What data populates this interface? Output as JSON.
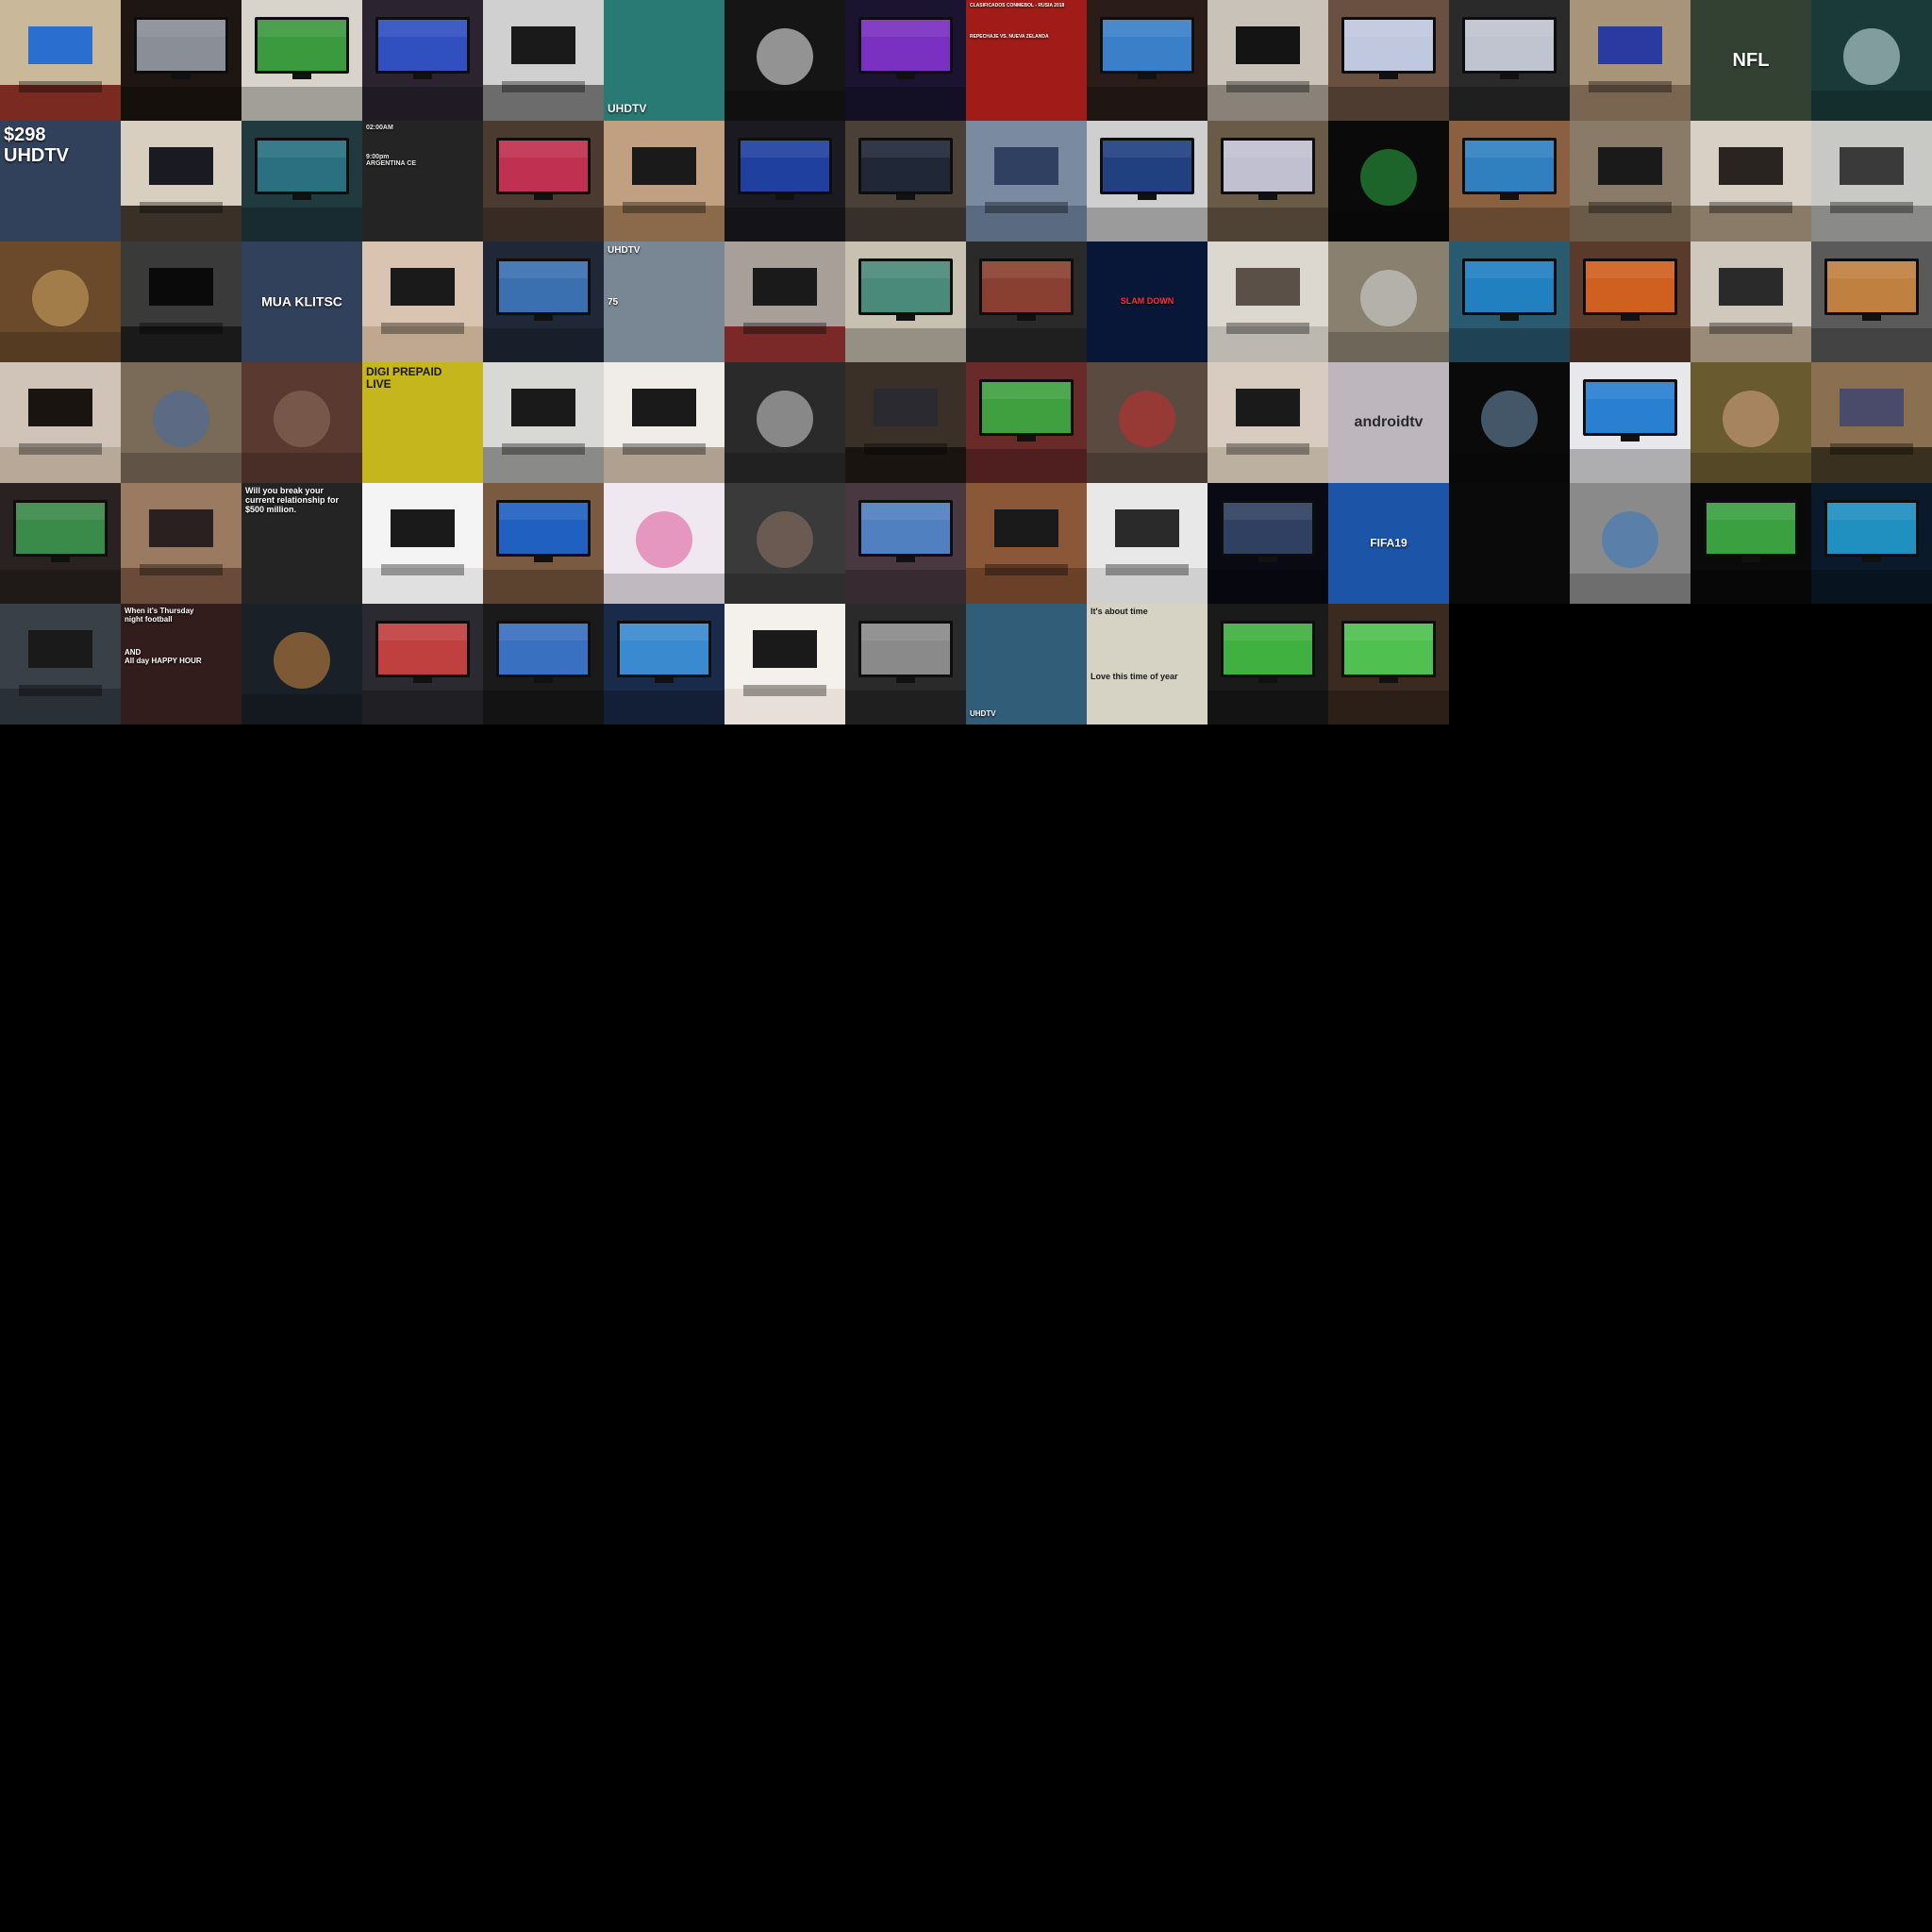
{
  "grid": {
    "columns": 16,
    "rows": 6,
    "background": "#000000"
  },
  "tiles": [
    {
      "name": "tile-restaurant-tv",
      "kind": "room",
      "bg": "#7a2a20",
      "wall": "#c9b89a",
      "tv": "#2a6fd0"
    },
    {
      "name": "tile-dark-room-projector",
      "kind": "tv",
      "bg": "#1e1612",
      "screen": "#8a8e96"
    },
    {
      "name": "tile-soccer-tv-cat",
      "kind": "tv",
      "bg": "#d8d4cc",
      "screen": "#3c9a3e"
    },
    {
      "name": "tile-cityscape-tv",
      "kind": "tv",
      "bg": "#2b2330",
      "screen": "#3050c0"
    },
    {
      "name": "tile-bw-living-room",
      "kind": "room",
      "bg": "#6c6c6c",
      "wall": "#d0d0d0",
      "tv": "#1a1a1a"
    },
    {
      "name": "tile-uhdtv-beach",
      "kind": "text",
      "bg": "#2f8a86",
      "color": "#ffffff",
      "pos": "bottom",
      "size": 12,
      "text": "UHDTV"
    },
    {
      "name": "tile-ps4-controller",
      "kind": "photo",
      "bg": "#151515",
      "accent": "#e8e8e8"
    },
    {
      "name": "tile-neon-game-tv",
      "kind": "tv",
      "bg": "#1a1430",
      "screen": "#7a30c0"
    },
    {
      "name": "tile-soccer-poster",
      "kind": "text",
      "bg": "#b8201c",
      "color": "#ffffff",
      "pos": "top",
      "size": 5,
      "text": "CLASIFICADOS CONMEBOL - RUSIA 2018\n\n\n\n\n\nREPECHAJE VS. NUEVA ZELANDA"
    },
    {
      "name": "tile-dark-lounge-tv",
      "kind": "tv",
      "bg": "#2a1c18",
      "screen": "#3a80c8"
    },
    {
      "name": "tile-speaker-wall",
      "kind": "room",
      "bg": "#8a8278",
      "wall": "#c8c2b8",
      "tv": "#141414"
    },
    {
      "name": "tile-bright-living-room",
      "kind": "tv",
      "bg": "#6a5040",
      "screen": "#c0c8e0"
    },
    {
      "name": "tile-gaming-desk",
      "kind": "tv",
      "bg": "#2a2a2a",
      "screen": "#c0c4d0"
    },
    {
      "name": "tile-wood-wall-unit",
      "kind": "room",
      "bg": "#7a6650",
      "wall": "#a89478",
      "tv": "#2a3aa0"
    },
    {
      "name": "tile-nfl-poster",
      "kind": "text",
      "bg": "#3a4a3a",
      "color": "#ffffff",
      "pos": "center",
      "size": 20,
      "text": "NFL"
    },
    {
      "name": "tile-snowglobe",
      "kind": "photo",
      "bg": "#1a3a3a",
      "accent": "#c8e0e0"
    },
    {
      "name": "tile-store-price",
      "kind": "text",
      "bg": "#3a4a68",
      "color": "#ffffff",
      "pos": "top",
      "size": 20,
      "text": "$298\nUHDTV"
    },
    {
      "name": "tile-plant-tv-stand",
      "kind": "room",
      "bg": "#3a3028",
      "wall": "#d8cfc0",
      "tv": "#1a1a22"
    },
    {
      "name": "tile-video-editor",
      "kind": "tv",
      "bg": "#203a40",
      "screen": "#2a7080"
    },
    {
      "name": "tile-world-cup-schedule",
      "kind": "text",
      "bg": "#2a2a2a",
      "color": "#e8e8e8",
      "pos": "top",
      "size": 7,
      "text": "02:00AM\n\n\n\n9:00pm\nARGENTINA   CE"
    },
    {
      "name": "tile-flowers-tv",
      "kind": "tv",
      "bg": "#4a3a30",
      "screen": "#c03050"
    },
    {
      "name": "tile-living-sofa",
      "kind": "room",
      "bg": "#8a6a4a",
      "wall": "#c0a080",
      "tv": "#1a1a1a"
    },
    {
      "name": "tile-aquarium-tv",
      "kind": "tv",
      "bg": "#1a1a20",
      "screen": "#2040a0"
    },
    {
      "name": "tile-home-theater-stand",
      "kind": "tv",
      "bg": "#4a4038",
      "screen": "#202838"
    },
    {
      "name": "tile-tv-box-store",
      "kind": "room",
      "bg": "#5a6a80",
      "wall": "#7a8aa0",
      "tv": "#304060"
    },
    {
      "name": "tile-checkered-rug",
      "kind": "tv",
      "bg": "#cfcfcf",
      "screen": "#204080"
    },
    {
      "name": "tile-cabinet-tv",
      "kind": "tv",
      "bg": "#6a5a48",
      "screen": "#c0c0d0"
    },
    {
      "name": "tile-silhouette-phone",
      "kind": "photo",
      "bg": "#0a0a0a",
      "accent": "#2aa040"
    },
    {
      "name": "tile-fireplace-tv",
      "kind": "tv",
      "bg": "#8a6040",
      "screen": "#3080c0"
    },
    {
      "name": "tile-dvd-wall",
      "kind": "room",
      "bg": "#6a5a48",
      "wall": "#8a7a68",
      "tv": "#1a1a1a"
    },
    {
      "name": "tile-wall-shelves",
      "kind": "room",
      "bg": "#8a7a68",
      "wall": "#d8d0c4",
      "tv": "#2a2420"
    },
    {
      "name": "tile-modern-lounge",
      "kind": "room",
      "bg": "#8a8a88",
      "wall": "#c8c8c4",
      "tv": "#3a3a3a"
    },
    {
      "name": "tile-buffet-food",
      "kind": "photo",
      "bg": "#6a4a2a",
      "accent": "#c8a060"
    },
    {
      "name": "tile-speakers-tv",
      "kind": "room",
      "bg": "#1a1a1a",
      "wall": "#3a3a3a",
      "tv": "#0a0a0a"
    },
    {
      "name": "tile-boxing-poster",
      "kind": "text",
      "bg": "#3a4a68",
      "color": "#ffffff",
      "pos": "center",
      "size": 14,
      "text": "MUA  KLITSC"
    },
    {
      "name": "tile-blank-wall-tv",
      "kind": "room",
      "bg": "#c0a890",
      "wall": "#d8c4b0",
      "tv": "#1a1a1a"
    },
    {
      "name": "tile-coast-tv",
      "kind": "tv",
      "bg": "#202838",
      "screen": "#3a70b0"
    },
    {
      "name": "tile-uhdtv-box-75",
      "kind": "text",
      "bg": "#8a9aaa",
      "color": "#ffffff",
      "pos": "top",
      "size": 10,
      "text": "UHDTV\n\n\n\n\n75"
    },
    {
      "name": "tile-red-wall-tv",
      "kind": "room",
      "bg": "#7a2828",
      "wall": "#a8a098",
      "tv": "#1a1a1a"
    },
    {
      "name": "tile-kids-tv",
      "kind": "tv",
      "bg": "#c8c0b0",
      "screen": "#4a8a7a"
    },
    {
      "name": "tile-bar-display",
      "kind": "tv",
      "bg": "#2a2a2a",
      "screen": "#8a4030"
    },
    {
      "name": "tile-wrestling-stage",
      "kind": "text",
      "bg": "#0a1a40",
      "color": "#ff3030",
      "pos": "center",
      "size": 9,
      "text": "SLAM DOWN"
    },
    {
      "name": "tile-marble-wall",
      "kind": "room",
      "bg": "#bcb8b0",
      "wall": "#dcd8d0",
      "tv": "#5a5048"
    },
    {
      "name": "tile-cans-pile",
      "kind": "photo",
      "bg": "#8a8070",
      "accent": "#d0d0d0"
    },
    {
      "name": "tile-palm-scuba",
      "kind": "tv",
      "bg": "#2a5a70",
      "screen": "#2080c0"
    },
    {
      "name": "tile-beer-fire-tv",
      "kind": "tv",
      "bg": "#5a3a2a",
      "screen": "#d06020"
    },
    {
      "name": "tile-open-plan-room",
      "kind": "room",
      "bg": "#9a8a78",
      "wall": "#d0c8bc",
      "tv": "#2a2a2a"
    },
    {
      "name": "tile-barn-landscape-tv",
      "kind": "tv",
      "bg": "#5a5a5a",
      "screen": "#c08040"
    },
    {
      "name": "tile-plain-wall-tv",
      "kind": "room",
      "bg": "#b8a898",
      "wall": "#d0c4b8",
      "tv": "#1a1410"
    },
    {
      "name": "tile-vacuum-floor",
      "kind": "photo",
      "bg": "#7a6a58",
      "accent": "#4a6aa0"
    },
    {
      "name": "tile-old-console",
      "kind": "photo",
      "bg": "#5a3a30",
      "accent": "#8a6a5a"
    },
    {
      "name": "tile-digi-prepaid",
      "kind": "text",
      "bg": "#e0d020",
      "color": "#1a1a1a",
      "pos": "top",
      "size": 12,
      "text": "DIGI PREPAID\nLIVE"
    },
    {
      "name": "tile-sunroom-tv",
      "kind": "room",
      "bg": "#8a8a88",
      "wall": "#d8d8d4",
      "tv": "#1a1a1a"
    },
    {
      "name": "tile-white-wall-tv",
      "kind": "room",
      "bg": "#b0a090",
      "wall": "#f0ece8",
      "tv": "#1a1a1a"
    },
    {
      "name": "tile-bw-abstract",
      "kind": "photo",
      "bg": "#2a2a2a",
      "accent": "#c8c8c8"
    },
    {
      "name": "tile-subwoofer-setup",
      "kind": "room",
      "bg": "#1a1410",
      "wall": "#3a3028",
      "tv": "#2a2a30"
    },
    {
      "name": "tile-mantel-soccer",
      "kind": "tv",
      "bg": "#6a2a2a",
      "screen": "#40a040"
    },
    {
      "name": "tile-collectibles-wall",
      "kind": "photo",
      "bg": "#5a4a40",
      "accent": "#c03030"
    },
    {
      "name": "tile-basement-frames",
      "kind": "room",
      "bg": "#bcb0a0",
      "wall": "#d8ccc0",
      "tv": "#1a1a1a"
    },
    {
      "name": "tile-androidtv",
      "kind": "text",
      "bg": "#d8d0d8",
      "color": "#2a2a2a",
      "pos": "center",
      "size": 16,
      "text": "androidtv"
    },
    {
      "name": "tile-cat-silhouette",
      "kind": "photo",
      "bg": "#0a0a0a",
      "accent": "#6a8aa8"
    },
    {
      "name": "tile-iceberg-tv",
      "kind": "tv",
      "bg": "#e8e8ec",
      "screen": "#2a80d0"
    },
    {
      "name": "tile-selfie-man",
      "kind": "photo",
      "bg": "#6a5a30",
      "accent": "#d0a080"
    },
    {
      "name": "tile-window-tv",
      "kind": "room",
      "bg": "#3a3020",
      "wall": "#8a7050",
      "tv": "#4a4a6a"
    },
    {
      "name": "tile-theater-room",
      "kind": "tv",
      "bg": "#2a2220",
      "screen": "#3a8a4a"
    },
    {
      "name": "tile-ornate-room",
      "kind": "room",
      "bg": "#6a4a38",
      "wall": "#9a7a60",
      "tv": "#2a2020"
    },
    {
      "name": "tile-money-stack",
      "kind": "text",
      "bg": "#2a2a2a",
      "color": "#ffffff",
      "pos": "top",
      "size": 9,
      "text": "Will you break your\ncurrent relationship for\n$500 million."
    },
    {
      "name": "tile-woman-red-tv",
      "kind": "room",
      "bg": "#e0e0e0",
      "wall": "#f4f4f4",
      "tv": "#1a1a1a"
    },
    {
      "name": "tile-man-tv-shelf",
      "kind": "tv",
      "bg": "#7a5a40",
      "screen": "#2060c0"
    },
    {
      "name": "tile-dollhouse",
      "kind": "photo",
      "bg": "#f0e8f0",
      "accent": "#e060a0"
    },
    {
      "name": "tile-bald-man-projector",
      "kind": "photo",
      "bg": "#3a3a3a",
      "accent": "#8a7060"
    },
    {
      "name": "tile-bed-tv",
      "kind": "tv",
      "bg": "#4a3840",
      "screen": "#5080c0"
    },
    {
      "name": "tile-kids-entertainment-unit",
      "kind": "room",
      "bg": "#6a4028",
      "wall": "#8a5838",
      "tv": "#1a1a1a"
    },
    {
      "name": "tile-floral-wallpaper",
      "kind": "room",
      "bg": "#d0d0d0",
      "wall": "#e8e8e8",
      "tv": "#2a2a2a"
    },
    {
      "name": "tile-blue-dark-room",
      "kind": "tv",
      "bg": "#0a0a14",
      "screen": "#304060"
    },
    {
      "name": "tile-fifa19",
      "kind": "text",
      "bg": "#2060c0",
      "color": "#ffffff",
      "pos": "center",
      "size": 12,
      "text": "FIFA19"
    },
    {
      "name": "tile-black-empty",
      "kind": "blank",
      "bg": "#0a0a0a"
    },
    {
      "name": "tile-cards-pile",
      "kind": "photo",
      "bg": "#8a8a8a",
      "accent": "#3a7ac0"
    },
    {
      "name": "tile-soccer-dark-tv",
      "kind": "tv",
      "bg": "#0a0a0a",
      "screen": "#3aa040"
    },
    {
      "name": "tile-aquarium-glow",
      "kind": "tv",
      "bg": "#0a1a2a",
      "screen": "#2090c0"
    },
    {
      "name": "tile-hotel-bed",
      "kind": "room",
      "bg": "#2a3038",
      "wall": "#3a4048",
      "tv": "#1a1a1a"
    },
    {
      "name": "tile-thursday-football",
      "kind": "text",
      "bg": "#3a2020",
      "color": "#ffffff",
      "pos": "top",
      "size": 8,
      "text": "When it's Thursday\nnight football\n\n\n\nAND\nAll day HAPPY HOUR"
    },
    {
      "name": "tile-dark-fantasy-city",
      "kind": "photo",
      "bg": "#1a2028",
      "accent": "#c08040"
    },
    {
      "name": "tile-bar-man",
      "kind": "tv",
      "bg": "#2a2a30",
      "screen": "#c04040"
    },
    {
      "name": "tile-gaming-setup",
      "kind": "tv",
      "bg": "#1a1a1a",
      "screen": "#3a70c0"
    },
    {
      "name": "tile-blue-room-tv",
      "kind": "tv",
      "bg": "#1a2a4a",
      "screen": "#3a8ad0"
    },
    {
      "name": "tile-split-room",
      "kind": "room",
      "bg": "#e8e0d8",
      "wall": "#f4f0ec",
      "tv": "#1a1a1a"
    },
    {
      "name": "tile-gray-screen",
      "kind": "tv",
      "bg": "#2a2a2a",
      "screen": "#8a8a8a"
    },
    {
      "name": "tile-uhdtv-girl",
      "kind": "text",
      "bg": "#3a6a8a",
      "color": "#ffffff",
      "pos": "bottom",
      "size": 8,
      "text": "UHDTV"
    },
    {
      "name": "tile-usa-map",
      "kind": "text",
      "bg": "#f4f0e0",
      "color": "#1a1a1a",
      "pos": "top",
      "size": 9,
      "text": "It's about time\n\n\n\n\n\n\nLove this time of year"
    },
    {
      "name": "tile-soccer-bright",
      "kind": "tv",
      "bg": "#1a1a1a",
      "screen": "#40b040"
    },
    {
      "name": "tile-soccer-wood-floor",
      "kind": "tv",
      "bg": "#3a2a20",
      "screen": "#50c050"
    }
  ]
}
